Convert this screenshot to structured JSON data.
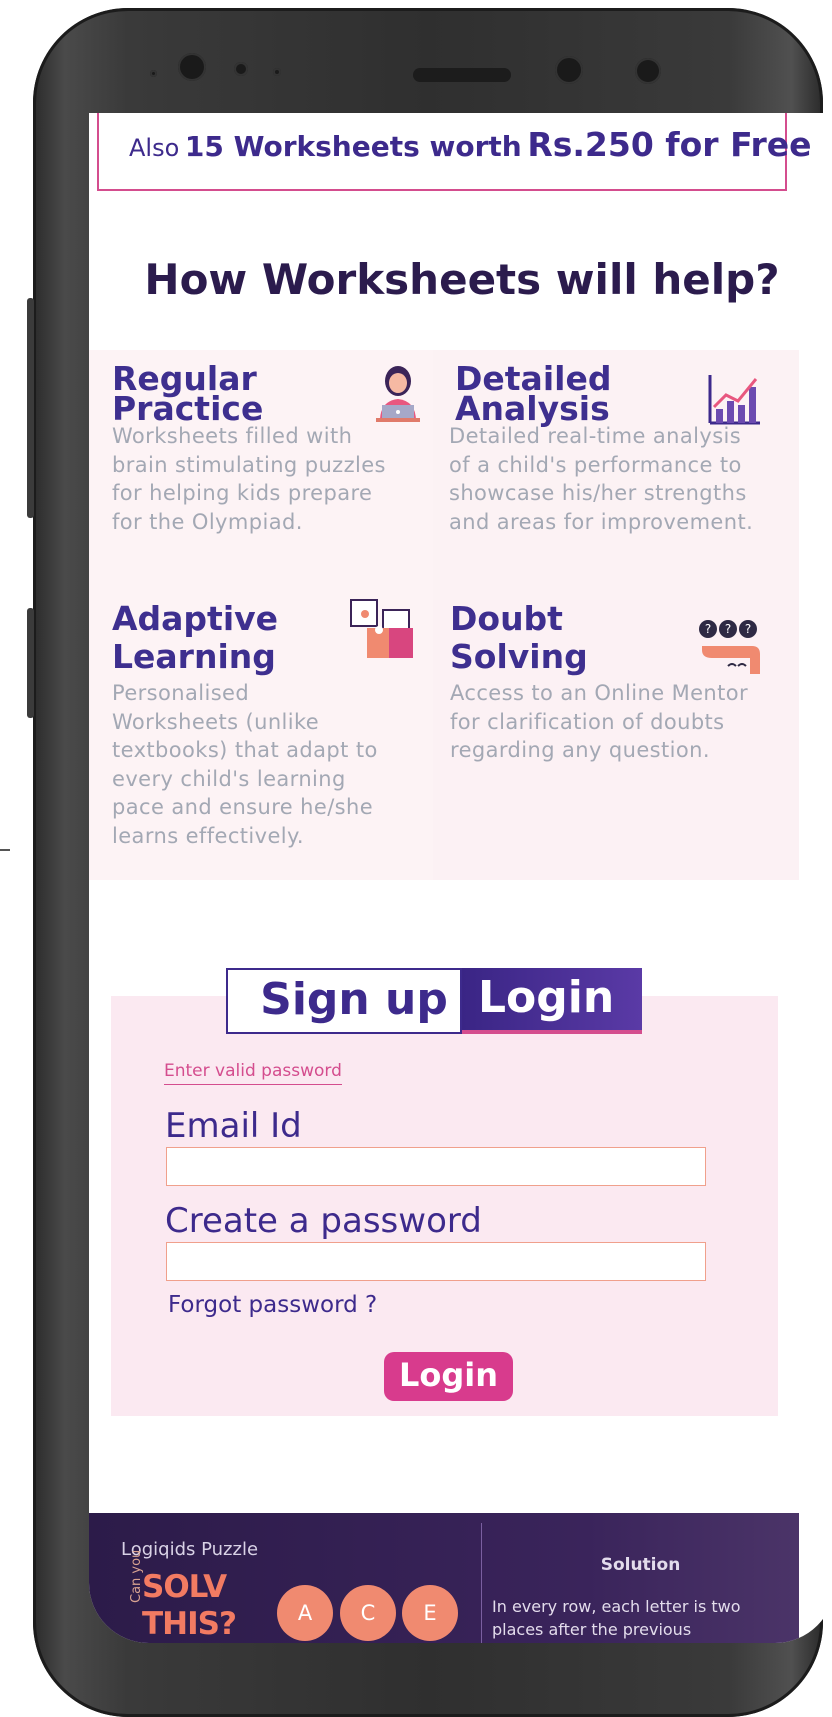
{
  "banner": {
    "line_prefix": "Also",
    "count": "15 Worksheets worth",
    "price": "Rs.250 for Free"
  },
  "section_title": "How Worksheets will help?",
  "features": [
    {
      "title_line1": "Regular",
      "title_line2": "Practice",
      "icon": "teacher-laptop-icon",
      "desc": [
        "Worksheets filled with",
        "brain stimulating puzzles",
        "for helping kids prepare",
        "for the Olympiad."
      ]
    },
    {
      "title_line1": "Detailed",
      "title_line2": "Analysis",
      "icon": "growth-chart-icon",
      "desc": [
        "Detailed real-time analysis",
        "of a child's performance to",
        "showcase his/her strengths",
        "and areas for improvement."
      ]
    },
    {
      "title_line1": "Adaptive",
      "title_line2": "Learning",
      "icon": "puzzle-pieces-icon",
      "desc": [
        "Personalised",
        "Worksheets (unlike",
        "textbooks) that adapt to",
        "every child's learning",
        "pace and ensure he/she",
        "learns effectively."
      ]
    },
    {
      "title_line1": "Doubt",
      "title_line2": "Solving",
      "icon": "question-bubbles-icon",
      "desc": [
        "Access to an Online Mentor",
        "for clarification of doubts",
        "regarding any question."
      ]
    }
  ],
  "auth": {
    "tab_signup": "Sign up",
    "tab_login": "Login",
    "active_tab": "Login",
    "error": "Enter valid password",
    "email_label": "Email Id",
    "email_value": "",
    "password_label": "Create a password",
    "password_value": "",
    "forgot": "Forgot password ?",
    "submit": "Login"
  },
  "puzzle": {
    "title": "Logiqids Puzzle",
    "can_you": "Can you",
    "solve_line1": "SOLV",
    "solve_line2": "THIS?",
    "balls": [
      "A",
      "C",
      "E"
    ],
    "solution_title": "Solution",
    "solution_text": "In every row, each letter is two places after the previous"
  },
  "colors": {
    "brand_purple": "#3d2a8c",
    "accent_pink": "#d44d8e",
    "card_bg": "#fdf3f5",
    "muted_text": "#a3a8b4"
  }
}
